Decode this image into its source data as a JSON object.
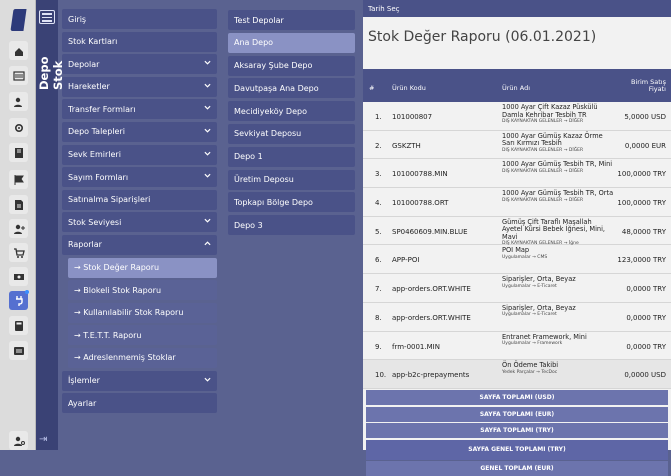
{
  "app": {
    "title": "Depo Stok"
  },
  "rail": {
    "icons": [
      "home-icon",
      "barcode-icon",
      "user-edit-icon",
      "gear-icon",
      "ledger-icon",
      "flag-icon",
      "document-icon",
      "user-add-icon",
      "cart-icon",
      "money-icon",
      "plug-icon",
      "calculator-icon",
      "ticket-icon"
    ],
    "bottom_icon": "user-gear-icon"
  },
  "menu": {
    "items": [
      {
        "label": "Giriş",
        "chevron": false
      },
      {
        "label": "Stok Kartları",
        "chevron": false
      },
      {
        "label": "Depolar",
        "chevron": true
      },
      {
        "label": "Hareketler",
        "chevron": true
      },
      {
        "label": "Transfer Formları",
        "chevron": true
      },
      {
        "label": "Depo Talepleri",
        "chevron": true
      },
      {
        "label": "Sevk Emirleri",
        "chevron": true
      },
      {
        "label": "Sayım Formları",
        "chevron": true
      },
      {
        "label": "Satınalma Siparişleri",
        "chevron": false
      },
      {
        "label": "Stok Seviyesi",
        "chevron": true
      },
      {
        "label": "Raporlar",
        "chevron": true
      }
    ],
    "report_sub": [
      "→ Stok Değer Raporu",
      "→ Blokeli Stok Raporu",
      "→ Kullanılabilir Stok Raporu",
      "→ T.E.T.T. Raporu",
      "→ Adreslenmemiş Stoklar"
    ],
    "after": [
      {
        "label": "İşlemler",
        "chevron": true
      },
      {
        "label": "Ayarlar",
        "chevron": false
      }
    ]
  },
  "depots": [
    "Test Depolar",
    "Ana Depo",
    "Aksaray Şube Depo",
    "Davutpaşa Ana Depo",
    "Mecidiyeköy Depo",
    "Sevkiyat Deposu",
    "Depo 1",
    "Üretim Deposu",
    "Topkapı Bölge Depo",
    "Depo 3"
  ],
  "report": {
    "date_label": "Tarih Seç",
    "title": "Stok Değer Raporu  (06.01.2021)",
    "columns": {
      "num": "#",
      "code": "Ürün Kodu",
      "name": "Ürün Adı",
      "price": "Birim Satış Fiyatı"
    },
    "rows": [
      {
        "n": "1.",
        "code": "101000807",
        "name": "1000 Ayar Çift Kazaz Püskülü Damla Kehribar Tesbih TR",
        "cat": "DIŞ KAYNAKTAN GELENLER → DİĞER",
        "price": "5,0000 USD"
      },
      {
        "n": "2.",
        "code": "GSKZTH",
        "name": "1000 Ayar Gümüş Kazaz Örme Sarı Kırmızı Tesbih",
        "cat": "DIŞ KAYNAKTAN GELENLER → DİĞER",
        "price": "0,0000 EUR"
      },
      {
        "n": "3.",
        "code": "101000788.MIN",
        "name": "1000 Ayar Gümüş Tesbih TR, Mini",
        "cat": "DIŞ KAYNAKTAN GELENLER → DİĞER",
        "price": "100,0000 TRY"
      },
      {
        "n": "4.",
        "code": "101000788.ORT",
        "name": "1000 Ayar Gümüş Tesbih TR, Orta",
        "cat": "DIŞ KAYNAKTAN GELENLER → DİĞER",
        "price": "100,0000 TRY"
      },
      {
        "n": "5.",
        "code": "SP0460609.MIN.BLUE",
        "name": "Gümüş Çift Taraflı Maşallah Ayetel Kürsi Bebek İğnesi, Mini, Mavi",
        "cat": "DIŞ KAYNAKTAN GELENLER → İğne",
        "price": "48,0000 TRY"
      },
      {
        "n": "6.",
        "code": "APP-POI",
        "name": "POI Map",
        "cat": "Uygulamalar → CMS",
        "price": "123,0000 TRY"
      },
      {
        "n": "7.",
        "code": "app-orders.ORT.WHITE",
        "name": "Siparişler, Orta, Beyaz",
        "cat": "Uygulamalar → E-Ticaret",
        "price": "0,0000 TRY"
      },
      {
        "n": "8.",
        "code": "app-orders.ORT.WHITE",
        "name": "Siparişler, Orta, Beyaz",
        "cat": "Uygulamalar → E-Ticaret",
        "price": "0,0000 TRY"
      },
      {
        "n": "9.",
        "code": "frm-0001.MIN",
        "name": "Entranet Framework, Mini",
        "cat": "Uygulamalar → Framework",
        "price": "0,0000 TRY"
      },
      {
        "n": "10.",
        "code": "app-b2c-prepayments",
        "name": "Ön Ödeme Takibi",
        "cat": "Yedek Parçalar → TecDoc",
        "price": "0,0000 USD"
      }
    ],
    "totals": [
      "SAYFA TOPLAMI (USD)",
      "SAYFA TOPLAMI (EUR)",
      "SAYFA TOPLAMI (TRY)",
      "SAYFA GENEL TOPLAMI (TRY)",
      "GENEL TOPLAM (EUR)"
    ]
  }
}
